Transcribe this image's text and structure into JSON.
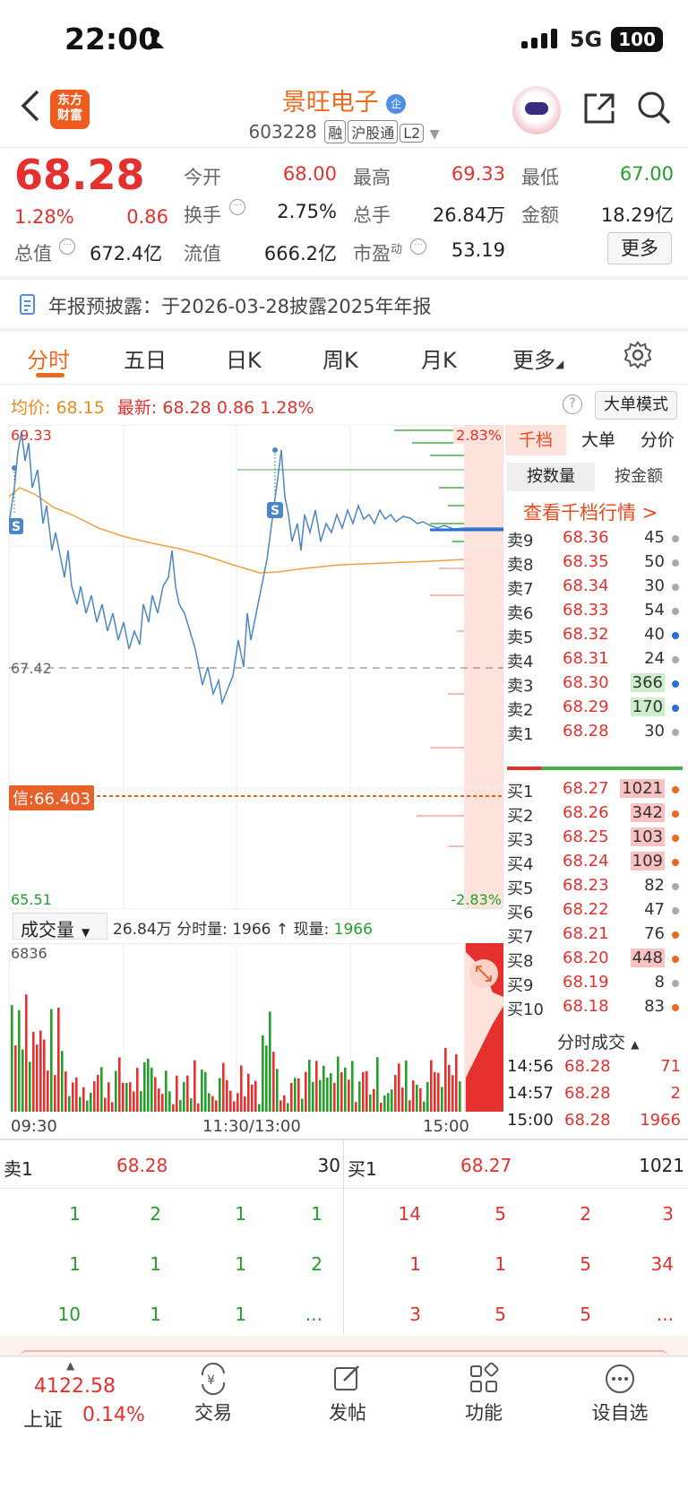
{
  "status_bar": {
    "time": "22:00",
    "network": "5G",
    "battery": "100"
  },
  "header": {
    "title": "景旺电子",
    "badge": "企",
    "code": "603228",
    "tags": [
      "融",
      "沪股通",
      "L2"
    ],
    "logo": "东方财富"
  },
  "quote": {
    "price": "68.28",
    "pct": "1.28%",
    "chg": "0.86",
    "open_label": "今开",
    "open": "68.00",
    "high_label": "最高",
    "high": "69.33",
    "low_label": "最低",
    "low": "67.00",
    "turnover_label": "换手",
    "turnover": "2.75%",
    "volume_label": "总手",
    "volume": "26.84万",
    "amount_label": "金额",
    "amount": "18.29亿",
    "mcap_label": "总值",
    "mcap": "672.4亿",
    "float_label": "流值",
    "float": "666.2亿",
    "pe_label": "市盈",
    "pe_sup": "动",
    "pe": "53.19",
    "more": "更多"
  },
  "notice": "年报预披露：于2026-03-28披露2025年年报",
  "tabs": [
    "分时",
    "五日",
    "日K",
    "周K",
    "月K",
    "更多"
  ],
  "chart_info": {
    "avg_label": "均价:",
    "avg": "68.15",
    "latest_label": "最新:",
    "latest": "68.28",
    "chg": "0.86",
    "pct": "1.28%",
    "big_mode": "大单模式"
  },
  "chart_data": {
    "type": "line",
    "y_max": "69.33",
    "y_mid": "67.42",
    "y_min": "65.51",
    "pct_top": "2.83%",
    "pct_bottom": "-2.83%",
    "credit_line": "信:66.403",
    "x_labels": [
      "09:30",
      "11:30/13:00",
      "15:00"
    ],
    "vol_header": "成交量",
    "vol_summary": "26.84万 分时量: 1966 ↑ 现量:",
    "vol_now": "1966",
    "vol_max": "6836"
  },
  "side_tabs": [
    "千档",
    "大单",
    "分价"
  ],
  "side_subtabs": [
    "按数量",
    "按金额"
  ],
  "side_link": "查看千档行情 >",
  "asks": [
    {
      "label": "卖9",
      "price": "68.36",
      "vol": "45",
      "dot": "#aaaaaa"
    },
    {
      "label": "卖8",
      "price": "68.35",
      "vol": "50",
      "dot": "#aaaaaa"
    },
    {
      "label": "卖7",
      "price": "68.34",
      "vol": "30",
      "dot": "#aaaaaa"
    },
    {
      "label": "卖6",
      "price": "68.33",
      "vol": "54",
      "dot": "#aaaaaa"
    },
    {
      "label": "卖5",
      "price": "68.32",
      "vol": "40",
      "dot": "#2b6ed6"
    },
    {
      "label": "卖4",
      "price": "68.31",
      "vol": "24",
      "dot": "#aaaaaa"
    },
    {
      "label": "卖3",
      "price": "68.30",
      "vol": "366",
      "dot": "#2b6ed6"
    },
    {
      "label": "卖2",
      "price": "68.29",
      "vol": "170",
      "dot": "#2b6ed6"
    },
    {
      "label": "卖1",
      "price": "68.28",
      "vol": "30",
      "dot": "#aaaaaa"
    }
  ],
  "bids": [
    {
      "label": "买1",
      "price": "68.27",
      "vol": "1021",
      "dot": "#ec6a1e"
    },
    {
      "label": "买2",
      "price": "68.26",
      "vol": "342",
      "dot": "#ec6a1e"
    },
    {
      "label": "买3",
      "price": "68.25",
      "vol": "103",
      "dot": "#ec6a1e"
    },
    {
      "label": "买4",
      "price": "68.24",
      "vol": "109",
      "dot": "#ec6a1e"
    },
    {
      "label": "买5",
      "price": "68.23",
      "vol": "82",
      "dot": "#aaaaaa"
    },
    {
      "label": "买6",
      "price": "68.22",
      "vol": "47",
      "dot": "#aaaaaa"
    },
    {
      "label": "买7",
      "price": "68.21",
      "vol": "76",
      "dot": "#ec6a1e"
    },
    {
      "label": "买8",
      "price": "68.20",
      "vol": "448",
      "dot": "#ec6a1e"
    },
    {
      "label": "买9",
      "price": "68.19",
      "vol": "8",
      "dot": "#aaaaaa"
    },
    {
      "label": "买10",
      "price": "68.18",
      "vol": "83",
      "dot": "#ec6a1e"
    }
  ],
  "ticks_title": "分时成交",
  "ticks": [
    {
      "time": "14:56",
      "price": "68.28",
      "vol": "71"
    },
    {
      "time": "14:57",
      "price": "68.28",
      "vol": "2"
    },
    {
      "time": "15:00",
      "price": "68.28",
      "vol": "1966"
    }
  ],
  "queue": {
    "sell_label": "卖1",
    "sell_price": "68.28",
    "sell_vol": "30",
    "buy_label": "买1",
    "buy_price": "68.27",
    "buy_vol": "1021",
    "sell_rows": [
      [
        "1",
        "2",
        "1",
        "1"
      ],
      [
        "1",
        "1",
        "1",
        "2"
      ],
      [
        "10",
        "1",
        "1",
        "..."
      ]
    ],
    "buy_rows": [
      [
        "14",
        "5",
        "2",
        "3"
      ],
      [
        "1",
        "1",
        "5",
        "34"
      ],
      [
        "3",
        "5",
        "5",
        "..."
      ]
    ]
  },
  "bottom_nav": {
    "index_value": "4122.58",
    "index_name": "上证",
    "index_pct": "0.14%",
    "items": [
      "交易",
      "发帖",
      "功能",
      "设自选"
    ]
  }
}
